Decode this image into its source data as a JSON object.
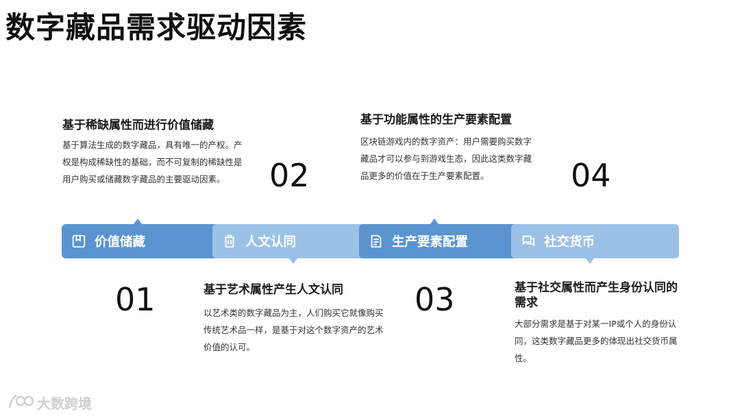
{
  "page": {
    "title": "数字藏品需求驱动因素"
  },
  "blocks": [
    {
      "number": "01",
      "heading": "基于稀缺属性而进行价值储藏",
      "body": "基于算法生成的数字藏品，具有唯一的产权。产权是构成稀缺性的基础，而不可复制的稀缺性是用户购买或储藏数字藏品的主要驱动因素。"
    },
    {
      "number": "02",
      "heading": "基于艺术属性产生人文认同",
      "body": "以艺术类的数字藏品为主，人们购买它就像购买传统艺术品一样，是基于对这个数字资产的艺术价值的认可。"
    },
    {
      "number": "03",
      "heading": "基于功能属性的生产要素配置",
      "body": "区块链游戏内的数字资产：用户需要购买数字藏品才可以参与到游戏生态，因此这类数字藏品更多的价值在于生产要素配置。"
    },
    {
      "number": "04",
      "heading": "基于社交属性而产生身份认同的需求",
      "body": "大部分需求是基于对某一IP或个人的身份认同，这类数字藏品更多的体现出社交货币属性。"
    }
  ],
  "timeline": [
    {
      "label": "价值储藏",
      "icon": "bookmark-box-icon",
      "color": "#5b93d1"
    },
    {
      "label": "人文认同",
      "icon": "trash-can-icon",
      "color": "#9bc1e6"
    },
    {
      "label": "生产要素配置",
      "icon": "document-edit-icon",
      "color": "#5b93d1"
    },
    {
      "label": "社交货币",
      "icon": "chat-bubbles-icon",
      "color": "#9bc1e6"
    }
  ],
  "watermark": {
    "text": "大数跨境",
    "icon": "brand-logo-icon"
  }
}
